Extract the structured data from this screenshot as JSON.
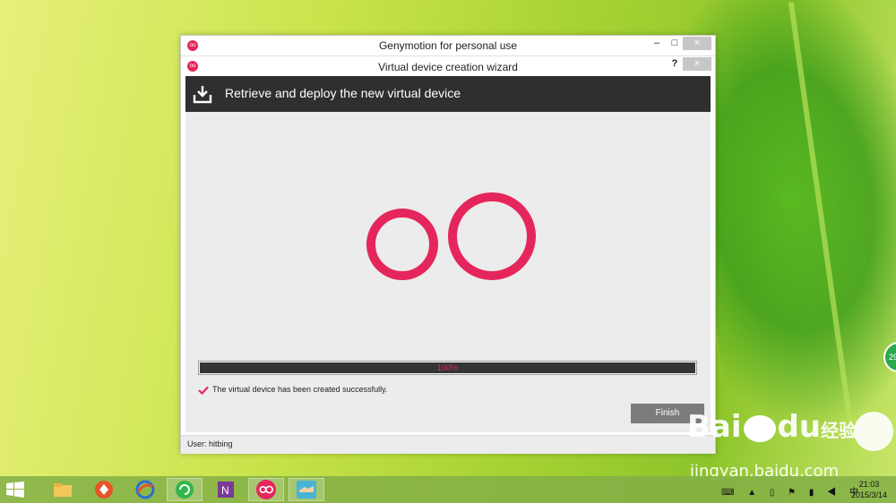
{
  "main_window": {
    "title": "Genymotion for personal use",
    "btn_minimize": "–",
    "btn_maximize": "□",
    "btn_close": "×"
  },
  "wizard": {
    "title": "Virtual device creation wizard",
    "btn_help": "?",
    "btn_close": "×",
    "header": "Retrieve and deploy the new virtual device",
    "progress": {
      "value": 1.0,
      "label": "100%"
    },
    "success_message": "The virtual device has been created successfully.",
    "finish_label": "Finish",
    "status_user": "User: hitbing"
  },
  "side_badge": {
    "text": "29"
  },
  "watermark": {
    "brand_left": "Bai",
    "brand_right": "du",
    "brand_cn": "经验",
    "url": "jingyan.baidu.com"
  },
  "taskbar": {
    "apps": [
      "file-explorer",
      "xunlei",
      "browser",
      "active-app",
      "onenote",
      "genymotion",
      "app"
    ],
    "clock_time": "21:03",
    "clock_date": "2015/3/14"
  },
  "colors": {
    "accent": "#e5265c",
    "header_bg": "#2f2f2f",
    "client_bg": "#ececec"
  }
}
